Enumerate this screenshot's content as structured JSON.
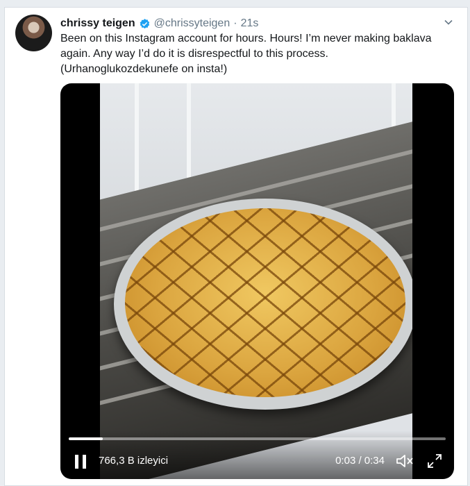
{
  "tweet": {
    "display_name": "chrissy teigen",
    "handle": "@chrissyteigen",
    "separator": "·",
    "timestamp": "21s",
    "text_lines": [
      "Been on this Instagram account for hours. Hours! I’m never making baklava",
      "again. Any way I’d do it is disrespectful to this process.",
      "(Urhanoglukozdekunefe on insta!)"
    ]
  },
  "video": {
    "views": "766,3 B izleyici",
    "time": "0:03 / 0:34",
    "progress_fraction": 0.09
  },
  "icons": {
    "verified": "verified-badge-icon",
    "caret": "chevron-down-icon",
    "pause": "pause-icon",
    "mute": "volume-muted-icon",
    "fullscreen": "fullscreen-icon"
  },
  "colors": {
    "verified": "#1da1f2",
    "text": "#14171a",
    "muted": "#657786"
  }
}
